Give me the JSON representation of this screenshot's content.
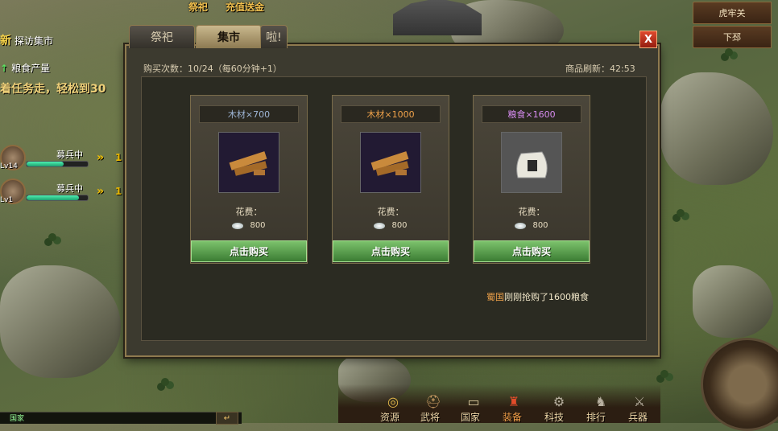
{
  "top_events": {
    "event1": "祭祀",
    "event2": "充值送金"
  },
  "right_nav": {
    "btn1": "虎牢关",
    "btn2": "下邳"
  },
  "quests": {
    "q1": "探访集市",
    "q1_prefix": "新",
    "q2": "粮食产量",
    "tip": "着任务走，轻松到30"
  },
  "generals": [
    {
      "lv": "Lv14",
      "status": "募兵中",
      "progress": 0.6,
      "arrow_num": "1"
    },
    {
      "lv": "Lv1",
      "status": "募兵中",
      "progress": 0.85,
      "arrow_num": "1"
    }
  ],
  "dialog": {
    "tabs": {
      "tab1": "祭祀",
      "tab2": "集市",
      "tab3": "啦!"
    },
    "close": "X",
    "purchase_info": "购买次数：10/24（每60分钟+1）",
    "refresh_info": "商品刷新：42:53",
    "cost_label": "花费：",
    "buy_label": "点击购买",
    "cards": [
      {
        "name": "木材×700",
        "name_color": "#9fb6d6",
        "cost": "800",
        "icon": "wood-icon"
      },
      {
        "name": "木材×1000",
        "name_color": "#f0a24a",
        "cost": "800",
        "icon": "wood-icon"
      },
      {
        "name": "粮食×1600",
        "name_color": "#d78cf0",
        "cost": "800",
        "icon": "grain-bag-icon"
      }
    ],
    "notice_name": "蜀国",
    "notice_text": "刚刚抢购了1600粮食"
  },
  "chat": {
    "tag": "国家",
    "send": "↵"
  },
  "bottom_nav": [
    "资源",
    "武将",
    "国家",
    "装备",
    "科技",
    "排行",
    "兵器"
  ]
}
